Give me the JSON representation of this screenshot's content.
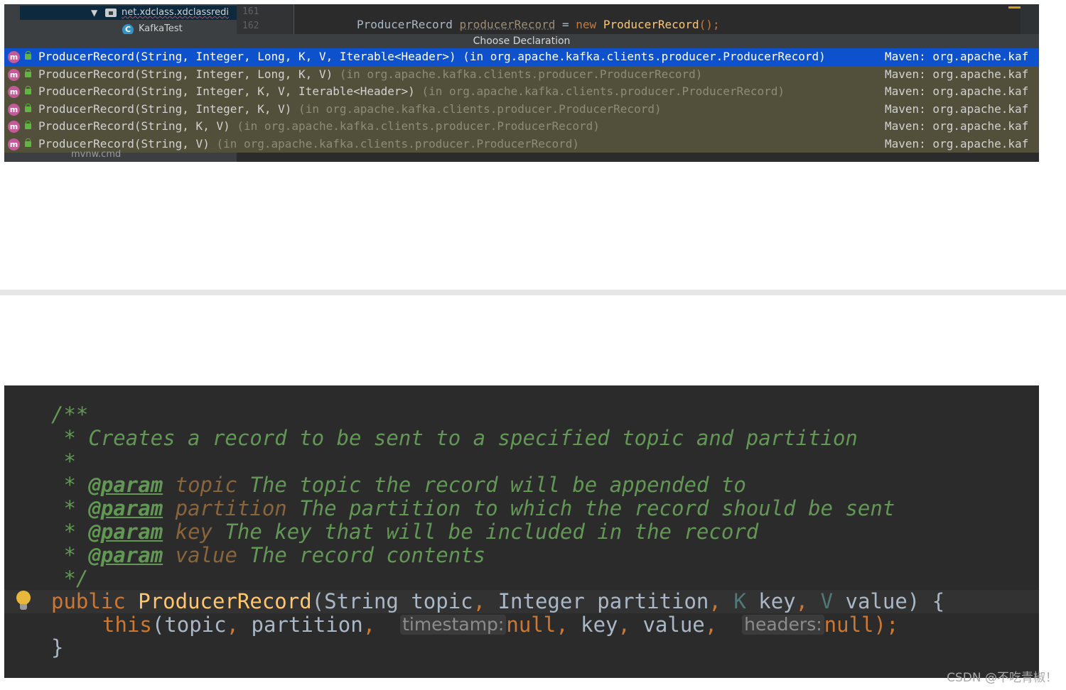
{
  "top_editor": {
    "tree": {
      "package_label": "net.xdclass.xdclassredi",
      "class_label": "KafkaTest",
      "partial_bottom_label": "mvnw.cmd"
    },
    "line_numbers": [
      "161",
      "162"
    ],
    "code_line": {
      "type": "ProducerRecord",
      "var": "producerRecord",
      "eq": " = ",
      "new_kw": "new",
      "ctor": "ProducerRecord",
      "tail": "();"
    },
    "popup": {
      "title": "Choose Declaration",
      "items": [
        {
          "sig": "ProducerRecord(String, Integer, Long, K, V, Iterable<Header>)",
          "loc": " (in org.apache.kafka.clients.producer.ProducerRecord)",
          "maven": "Maven: org.apache.kaf"
        },
        {
          "sig": "ProducerRecord(String, Integer, Long, K, V)",
          "loc": " (in org.apache.kafka.clients.producer.ProducerRecord)",
          "maven": "Maven: org.apache.kaf"
        },
        {
          "sig": "ProducerRecord(String, Integer, K, V, Iterable<Header>)",
          "loc": " (in org.apache.kafka.clients.producer.ProducerRecord)",
          "maven": "Maven: org.apache.kaf"
        },
        {
          "sig": "ProducerRecord(String, Integer, K, V)",
          "loc": " (in org.apache.kafka.clients.producer.ProducerRecord)",
          "maven": "Maven: org.apache.kaf"
        },
        {
          "sig": "ProducerRecord(String, K, V)",
          "loc": " (in org.apache.kafka.clients.producer.ProducerRecord)",
          "maven": "Maven: org.apache.kaf"
        },
        {
          "sig": "ProducerRecord(String, V)",
          "loc": " (in org.apache.kafka.clients.producer.ProducerRecord)",
          "maven": "Maven: org.apache.kaf"
        }
      ]
    }
  },
  "bottom_editor": {
    "doc_open": "/**",
    "doc_summary": " * Creates a record to be sent to a specified topic and partition",
    "doc_blank": " *",
    "star": " * ",
    "param_tag": "@param",
    "params": [
      {
        "name": "topic",
        "desc": " The topic the record will be appended to"
      },
      {
        "name": "partition",
        "desc": " The partition to which the record should be sent"
      },
      {
        "name": "key",
        "desc": " The key that will be included in the record"
      },
      {
        "name": "value",
        "desc": " The record contents"
      }
    ],
    "doc_close": " */",
    "sig": {
      "public_kw": "public",
      "ctor_name": "ProducerRecord",
      "p1": "(String topic",
      "c1": ",",
      "p2": " Integer partition",
      "c2": ",",
      "k": " K",
      "p3": " key",
      "c3": ",",
      "v": " V",
      "p4": " value) {"
    },
    "body": {
      "this_kw": "this",
      "args1": "(topic",
      "c1": ",",
      "args2": " partition",
      "c2": ",",
      "hint1": "timestamp:",
      "null1": "null",
      "c3": ",",
      "args3": " key",
      "c4": ",",
      "args4": " value",
      "c5": ",",
      "hint2": "headers:",
      "null2": "null",
      "tail": ");"
    },
    "close_brace": "}"
  },
  "watermark": "CSDN @不吃青椒！"
}
